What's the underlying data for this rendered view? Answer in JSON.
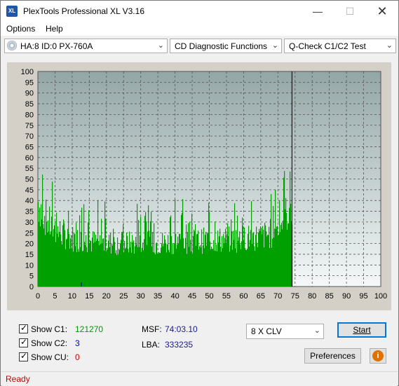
{
  "window": {
    "title": "PlexTools Professional XL V3.16",
    "icon_label": "XL"
  },
  "menu": {
    "options": "Options",
    "help": "Help"
  },
  "toolbar": {
    "drive": "HA:8 ID:0  PX-760A",
    "function": "CD Diagnostic Functions",
    "test": "Q-Check C1/C2 Test"
  },
  "chart_data": {
    "type": "bar",
    "series": [
      {
        "name": "C1",
        "color": "#00a000",
        "note_values": "per-sector-group error counts, approximate envelope",
        "envelope": [
          [
            0,
            57
          ],
          [
            1,
            52
          ],
          [
            2,
            48
          ],
          [
            3,
            44
          ],
          [
            5,
            40
          ],
          [
            8,
            37
          ],
          [
            10,
            35
          ],
          [
            15,
            33
          ],
          [
            20,
            32
          ],
          [
            25,
            32
          ],
          [
            30,
            32
          ],
          [
            35,
            32
          ],
          [
            40,
            33
          ],
          [
            45,
            33
          ],
          [
            50,
            34
          ],
          [
            55,
            34
          ],
          [
            60,
            35
          ],
          [
            65,
            36
          ],
          [
            68,
            38
          ],
          [
            70,
            42
          ],
          [
            72,
            48
          ],
          [
            73,
            52
          ],
          [
            74,
            56
          ],
          [
            74.1,
            0
          ]
        ]
      },
      {
        "name": "C2",
        "color": "#0000cc",
        "values": [
          [
            12.5,
            2
          ]
        ]
      }
    ],
    "xlim": [
      0,
      100
    ],
    "ylim": [
      0,
      100
    ],
    "x_ticks": [
      "0",
      "5",
      "10",
      "15",
      "20",
      "25",
      "30",
      "35",
      "40",
      "45",
      "50",
      "55",
      "60",
      "65",
      "70",
      "75",
      "80",
      "85",
      "90",
      "95",
      "100"
    ],
    "y_ticks": [
      "0",
      "5",
      "10",
      "15",
      "20",
      "25",
      "30",
      "35",
      "40",
      "45",
      "50",
      "55",
      "60",
      "65",
      "70",
      "75",
      "80",
      "85",
      "90",
      "95",
      "100"
    ],
    "end_marker_x": 74.1,
    "grid": true
  },
  "stats": {
    "c1_label": "Show C1:",
    "c1_value": "121270",
    "c1_color": "#009900",
    "c2_label": "Show C2:",
    "c2_value": "3",
    "c2_color": "#0000cc",
    "cu_label": "Show CU:",
    "cu_value": "0",
    "cu_color": "#cc0000",
    "msf_label": "MSF:",
    "msf_value": "74:03.10",
    "lba_label": "LBA:",
    "lba_value": "333235"
  },
  "controls": {
    "speed": "8 X CLV",
    "start": "Start",
    "preferences": "Preferences",
    "info_icon": "info-icon"
  },
  "status": {
    "text": "Ready"
  }
}
